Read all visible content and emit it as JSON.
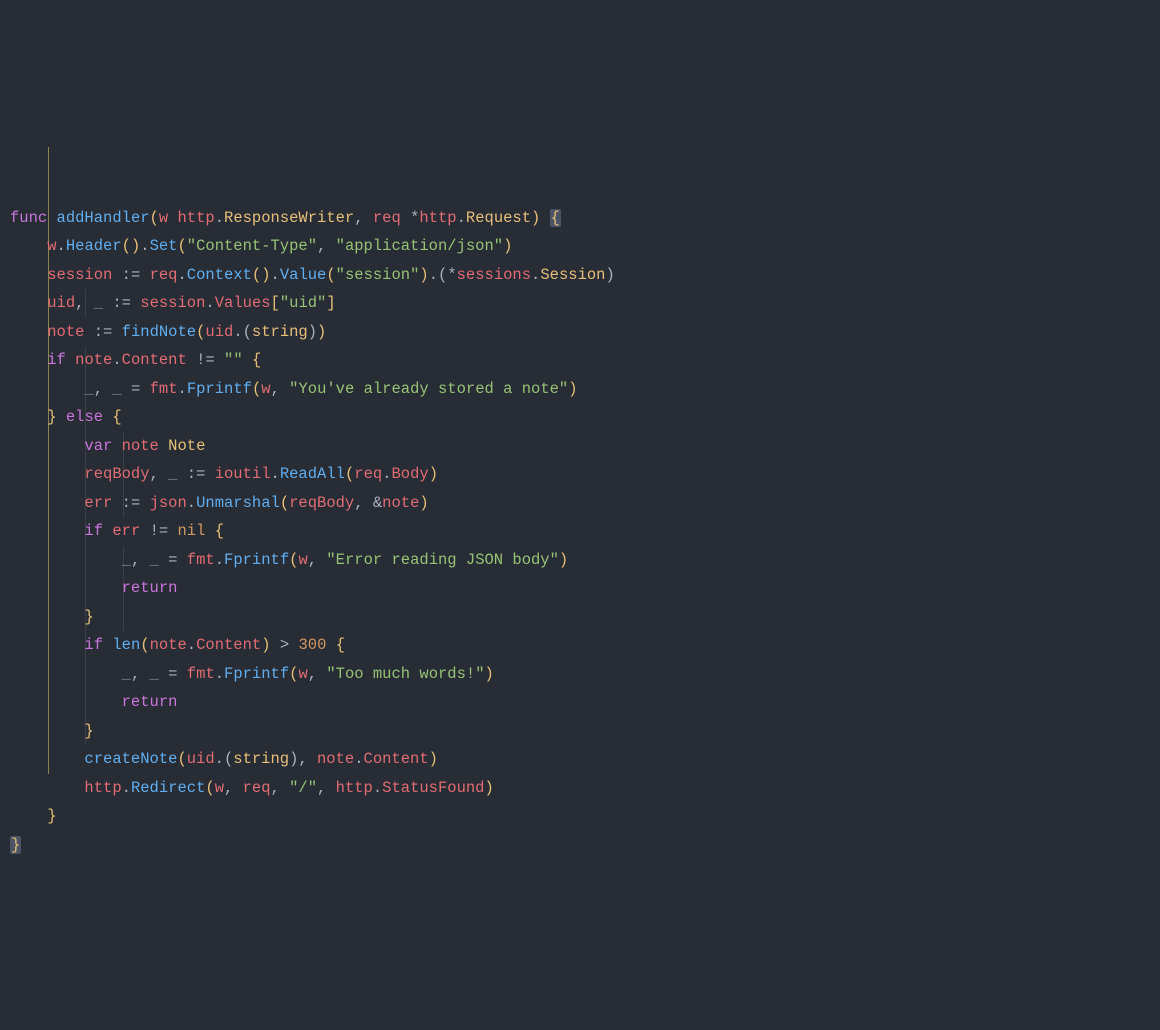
{
  "language": "go",
  "theme": {
    "bg": "#282c34",
    "fg": "#abb2bf",
    "keyword": "#c776dc",
    "function": "#60aeef",
    "identifier": "#e06c75",
    "type": "#e5c07b",
    "string": "#97c278",
    "number": "#d19a66",
    "punct": "#e5c07b",
    "muted": "#7f848e",
    "guide": "#3b4048",
    "guide_active": "#ccc166",
    "bracket_highlight": "#4b5364"
  },
  "indent_guides": [
    {
      "col": 1,
      "top_line": 1,
      "bottom_line": 22,
      "active": true
    },
    {
      "col": 2,
      "top_line": 6,
      "bottom_line": 6,
      "active": false
    },
    {
      "col": 2,
      "top_line": 8,
      "bottom_line": 21,
      "active": false
    },
    {
      "col": 3,
      "top_line": 11,
      "bottom_line": 13,
      "active": false
    },
    {
      "col": 3,
      "top_line": 15,
      "bottom_line": 17,
      "active": false
    }
  ],
  "lines": [
    [
      {
        "c": "kw",
        "t": "func"
      },
      {
        "t": " "
      },
      {
        "c": "fn",
        "t": "addHandler"
      },
      {
        "c": "pn",
        "t": "("
      },
      {
        "c": "id",
        "t": "w"
      },
      {
        "t": " "
      },
      {
        "c": "id",
        "t": "http"
      },
      {
        "t": "."
      },
      {
        "c": "ty",
        "t": "ResponseWriter"
      },
      {
        "t": ", "
      },
      {
        "c": "id",
        "t": "req"
      },
      {
        "t": " "
      },
      {
        "c": "op",
        "t": "*"
      },
      {
        "c": "id",
        "t": "http"
      },
      {
        "t": "."
      },
      {
        "c": "ty",
        "t": "Request"
      },
      {
        "c": "pn",
        "t": ")"
      },
      {
        "t": " "
      },
      {
        "c": "pn hl-brace",
        "t": "{"
      }
    ],
    [
      {
        "t": "    "
      },
      {
        "c": "id",
        "t": "w"
      },
      {
        "t": "."
      },
      {
        "c": "fn",
        "t": "Header"
      },
      {
        "c": "pn",
        "t": "()"
      },
      {
        "t": "."
      },
      {
        "c": "fn",
        "t": "Set"
      },
      {
        "c": "pn",
        "t": "("
      },
      {
        "c": "str",
        "t": "\"Content-Type\""
      },
      {
        "t": ", "
      },
      {
        "c": "str",
        "t": "\"application/json\""
      },
      {
        "c": "pn",
        "t": ")"
      }
    ],
    [
      {
        "t": "    "
      },
      {
        "c": "id",
        "t": "session"
      },
      {
        "t": " "
      },
      {
        "c": "op",
        "t": ":="
      },
      {
        "t": " "
      },
      {
        "c": "id",
        "t": "req"
      },
      {
        "t": "."
      },
      {
        "c": "fn",
        "t": "Context"
      },
      {
        "c": "pn",
        "t": "()"
      },
      {
        "t": "."
      },
      {
        "c": "fn",
        "t": "Value"
      },
      {
        "c": "pn",
        "t": "("
      },
      {
        "c": "str",
        "t": "\"session\""
      },
      {
        "c": "pn",
        "t": ")"
      },
      {
        "t": ".("
      },
      {
        "c": "op",
        "t": "*"
      },
      {
        "c": "id",
        "t": "sessions"
      },
      {
        "t": "."
      },
      {
        "c": "ty",
        "t": "Session"
      },
      {
        "t": ")"
      }
    ],
    [
      {
        "t": "    "
      },
      {
        "c": "id",
        "t": "uid"
      },
      {
        "t": ", "
      },
      {
        "c": "muted",
        "t": "_"
      },
      {
        "t": " "
      },
      {
        "c": "op",
        "t": ":="
      },
      {
        "t": " "
      },
      {
        "c": "id",
        "t": "session"
      },
      {
        "t": "."
      },
      {
        "c": "id",
        "t": "Values"
      },
      {
        "c": "pn",
        "t": "["
      },
      {
        "c": "str",
        "t": "\"uid\""
      },
      {
        "c": "pn",
        "t": "]"
      }
    ],
    [
      {
        "t": "    "
      },
      {
        "c": "id",
        "t": "note"
      },
      {
        "t": " "
      },
      {
        "c": "op",
        "t": ":="
      },
      {
        "t": " "
      },
      {
        "c": "fn",
        "t": "findNote"
      },
      {
        "c": "pn",
        "t": "("
      },
      {
        "c": "id",
        "t": "uid"
      },
      {
        "t": ".("
      },
      {
        "c": "ty",
        "t": "string"
      },
      {
        "t": ")"
      },
      {
        "c": "pn",
        "t": ")"
      }
    ],
    [
      {
        "t": "    "
      },
      {
        "c": "kw",
        "t": "if"
      },
      {
        "t": " "
      },
      {
        "c": "id",
        "t": "note"
      },
      {
        "t": "."
      },
      {
        "c": "id",
        "t": "Content"
      },
      {
        "t": " "
      },
      {
        "c": "op",
        "t": "!="
      },
      {
        "t": " "
      },
      {
        "c": "str",
        "t": "\"\""
      },
      {
        "t": " "
      },
      {
        "c": "pn",
        "t": "{"
      }
    ],
    [
      {
        "t": "        "
      },
      {
        "c": "muted",
        "t": "_"
      },
      {
        "t": ", "
      },
      {
        "c": "muted",
        "t": "_"
      },
      {
        "t": " "
      },
      {
        "c": "op",
        "t": "="
      },
      {
        "t": " "
      },
      {
        "c": "id",
        "t": "fmt"
      },
      {
        "t": "."
      },
      {
        "c": "fn",
        "t": "Fprintf"
      },
      {
        "c": "pn",
        "t": "("
      },
      {
        "c": "id",
        "t": "w"
      },
      {
        "t": ", "
      },
      {
        "c": "str",
        "t": "\"You've already stored a note\""
      },
      {
        "c": "pn",
        "t": ")"
      }
    ],
    [
      {
        "t": "    "
      },
      {
        "c": "pn",
        "t": "}"
      },
      {
        "t": " "
      },
      {
        "c": "kw",
        "t": "else"
      },
      {
        "t": " "
      },
      {
        "c": "pn",
        "t": "{"
      }
    ],
    [
      {
        "t": "        "
      },
      {
        "c": "kw",
        "t": "var"
      },
      {
        "t": " "
      },
      {
        "c": "id",
        "t": "note"
      },
      {
        "t": " "
      },
      {
        "c": "ty",
        "t": "Note"
      }
    ],
    [
      {
        "t": "        "
      },
      {
        "c": "id",
        "t": "reqBody"
      },
      {
        "t": ", "
      },
      {
        "c": "muted",
        "t": "_"
      },
      {
        "t": " "
      },
      {
        "c": "op",
        "t": ":="
      },
      {
        "t": " "
      },
      {
        "c": "id",
        "t": "ioutil"
      },
      {
        "t": "."
      },
      {
        "c": "fn",
        "t": "ReadAll"
      },
      {
        "c": "pn",
        "t": "("
      },
      {
        "c": "id",
        "t": "req"
      },
      {
        "t": "."
      },
      {
        "c": "id",
        "t": "Body"
      },
      {
        "c": "pn",
        "t": ")"
      }
    ],
    [
      {
        "t": "        "
      },
      {
        "c": "id",
        "t": "err"
      },
      {
        "t": " "
      },
      {
        "c": "op",
        "t": ":="
      },
      {
        "t": " "
      },
      {
        "c": "id",
        "t": "json"
      },
      {
        "t": "."
      },
      {
        "c": "fn",
        "t": "Unmarshal"
      },
      {
        "c": "pn",
        "t": "("
      },
      {
        "c": "id",
        "t": "reqBody"
      },
      {
        "t": ", "
      },
      {
        "c": "op",
        "t": "&"
      },
      {
        "c": "id",
        "t": "note"
      },
      {
        "c": "pn",
        "t": ")"
      }
    ],
    [
      {
        "t": "        "
      },
      {
        "c": "kw",
        "t": "if"
      },
      {
        "t": " "
      },
      {
        "c": "id",
        "t": "err"
      },
      {
        "t": " "
      },
      {
        "c": "op",
        "t": "!="
      },
      {
        "t": " "
      },
      {
        "c": "num",
        "t": "nil"
      },
      {
        "t": " "
      },
      {
        "c": "pn",
        "t": "{"
      }
    ],
    [
      {
        "t": "            "
      },
      {
        "c": "muted",
        "t": "_"
      },
      {
        "t": ", "
      },
      {
        "c": "muted",
        "t": "_"
      },
      {
        "t": " "
      },
      {
        "c": "op",
        "t": "="
      },
      {
        "t": " "
      },
      {
        "c": "id",
        "t": "fmt"
      },
      {
        "t": "."
      },
      {
        "c": "fn",
        "t": "Fprintf"
      },
      {
        "c": "pn",
        "t": "("
      },
      {
        "c": "id",
        "t": "w"
      },
      {
        "t": ", "
      },
      {
        "c": "str",
        "t": "\"Error reading JSON body\""
      },
      {
        "c": "pn",
        "t": ")"
      }
    ],
    [
      {
        "t": "            "
      },
      {
        "c": "kw",
        "t": "return"
      }
    ],
    [
      {
        "t": "        "
      },
      {
        "c": "pn",
        "t": "}"
      }
    ],
    [
      {
        "t": "        "
      },
      {
        "c": "kw",
        "t": "if"
      },
      {
        "t": " "
      },
      {
        "c": "fn",
        "t": "len"
      },
      {
        "c": "pn",
        "t": "("
      },
      {
        "c": "id",
        "t": "note"
      },
      {
        "t": "."
      },
      {
        "c": "id",
        "t": "Content"
      },
      {
        "c": "pn",
        "t": ")"
      },
      {
        "t": " "
      },
      {
        "c": "op",
        "t": ">"
      },
      {
        "t": " "
      },
      {
        "c": "num",
        "t": "300"
      },
      {
        "t": " "
      },
      {
        "c": "pn",
        "t": "{"
      }
    ],
    [
      {
        "t": "            "
      },
      {
        "c": "muted",
        "t": "_"
      },
      {
        "t": ", "
      },
      {
        "c": "muted",
        "t": "_"
      },
      {
        "t": " "
      },
      {
        "c": "op",
        "t": "="
      },
      {
        "t": " "
      },
      {
        "c": "id",
        "t": "fmt"
      },
      {
        "t": "."
      },
      {
        "c": "fn",
        "t": "Fprintf"
      },
      {
        "c": "pn",
        "t": "("
      },
      {
        "c": "id",
        "t": "w"
      },
      {
        "t": ", "
      },
      {
        "c": "str",
        "t": "\"Too much words!\""
      },
      {
        "c": "pn",
        "t": ")"
      }
    ],
    [
      {
        "t": "            "
      },
      {
        "c": "kw",
        "t": "return"
      }
    ],
    [
      {
        "t": "        "
      },
      {
        "c": "pn",
        "t": "}"
      }
    ],
    [
      {
        "t": "        "
      },
      {
        "c": "fn",
        "t": "createNote"
      },
      {
        "c": "pn",
        "t": "("
      },
      {
        "c": "id",
        "t": "uid"
      },
      {
        "t": ".("
      },
      {
        "c": "ty",
        "t": "string"
      },
      {
        "t": ")"
      },
      {
        "t": ", "
      },
      {
        "c": "id",
        "t": "note"
      },
      {
        "t": "."
      },
      {
        "c": "id",
        "t": "Content"
      },
      {
        "c": "pn",
        "t": ")"
      }
    ],
    [
      {
        "t": "        "
      },
      {
        "c": "id",
        "t": "http"
      },
      {
        "t": "."
      },
      {
        "c": "fn",
        "t": "Redirect"
      },
      {
        "c": "pn",
        "t": "("
      },
      {
        "c": "id",
        "t": "w"
      },
      {
        "t": ", "
      },
      {
        "c": "id",
        "t": "req"
      },
      {
        "t": ", "
      },
      {
        "c": "str",
        "t": "\"/\""
      },
      {
        "t": ", "
      },
      {
        "c": "id",
        "t": "http"
      },
      {
        "t": "."
      },
      {
        "c": "id",
        "t": "StatusFound"
      },
      {
        "c": "pn",
        "t": ")"
      }
    ],
    [
      {
        "t": "    "
      },
      {
        "c": "pn",
        "t": "}"
      }
    ],
    [
      {
        "c": "pn hl-brace",
        "t": "}"
      }
    ]
  ]
}
